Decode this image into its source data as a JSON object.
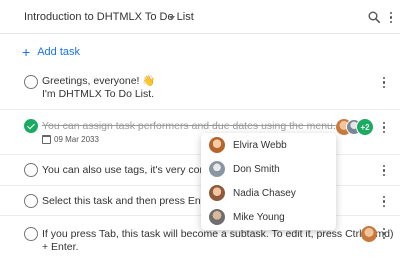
{
  "header": {
    "title": "Introduction to DHTMLX To Do List",
    "title_icon": "caret-down-icon",
    "search_icon": "search-icon",
    "more_icon": "more-vertical-icon"
  },
  "add_task": {
    "icon": "plus-icon",
    "label": "Add task"
  },
  "tasks": [
    {
      "checked": false,
      "lines": [
        "Greetings, everyone! 👋",
        "I'm DHTMLX To Do List."
      ]
    },
    {
      "checked": true,
      "lines": [
        "You can assign task performers and due dates using the menu."
      ],
      "due_date": "09 Mar 2033",
      "extra_assignees": "+2"
    },
    {
      "checked": false,
      "lines": [
        "You can also use tags, it's very convenie"
      ]
    },
    {
      "checked": false,
      "lines": [
        "Select this task and then press Enter to"
      ]
    },
    {
      "checked": false,
      "lines": [
        "If you press Tab, this task will become a subtask. To edit it, press Ctrl (Cmd)",
        "+ Enter."
      ]
    }
  ],
  "assignee_menu": {
    "people": [
      {
        "name": "Elvira Webb"
      },
      {
        "name": "Don Smith"
      },
      {
        "name": "Nadia Chasey"
      },
      {
        "name": "Mike Young"
      }
    ]
  },
  "colors": {
    "accent": "#1a73e8",
    "done_green": "#1aab63"
  }
}
